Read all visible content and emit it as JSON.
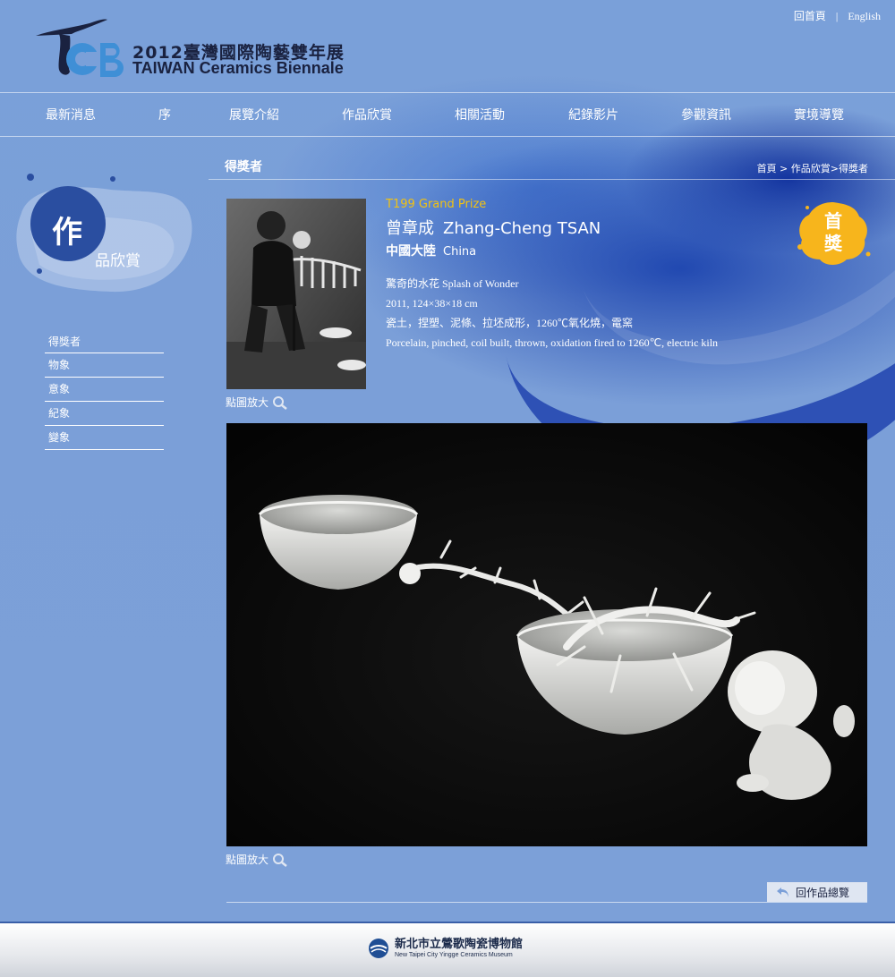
{
  "header": {
    "logo_cn": "2012臺灣國際陶藝雙年展",
    "logo_en": "TAIWAN Ceramics Biennale",
    "home_link": "回首頁",
    "separator": "|",
    "english_link": "English"
  },
  "nav": {
    "items": [
      "最新消息",
      "序",
      "展覽介紹",
      "作品欣賞",
      "相關活動",
      "紀錄影片",
      "參觀資訊",
      "實境導覽"
    ]
  },
  "sidebar": {
    "title_big": "作",
    "title_small": "品欣賞",
    "items": [
      "得獎者",
      "物象",
      "意象",
      "紀象",
      "變象"
    ]
  },
  "content": {
    "title": "得獎者",
    "breadcrumb": {
      "home": "首頁",
      "sep1": " > ",
      "section": "作品欣賞",
      "sep2": ">",
      "current": "得獎者"
    },
    "zoom_label": "點圖放大",
    "prize_code": "T199 Grand Prize",
    "artist_name_cn": "曾章成",
    "artist_name_en": "Zhang-Cheng TSAN",
    "country_cn": "中國大陸",
    "country_en": "China",
    "work_title": "驚奇的水花  Splash of Wonder",
    "work_dims": "2011, 124×38×18 cm",
    "work_material_cn": "瓷土，捏塑、泥條、拉坯成形，1260℃氧化燒，電窯",
    "work_material_en": "Porcelain, pinched, coil built, thrown, oxidation fired to 1260℃, electric kiln",
    "award_badge": "首獎",
    "back_button": "回作品總覽"
  },
  "footer": {
    "museum_cn": "新北市立鶯歌陶瓷博物館",
    "museum_en": "New Taipei City Yingge Ceramics Museum"
  },
  "colors": {
    "background": "#7b9fd8",
    "accent_gold": "#f2c211",
    "badge_yellow": "#f7b51c",
    "dark_navy": "#1a2240"
  },
  "icons": {
    "zoom": "magnifier-icon",
    "back": "return-arrow-icon"
  }
}
